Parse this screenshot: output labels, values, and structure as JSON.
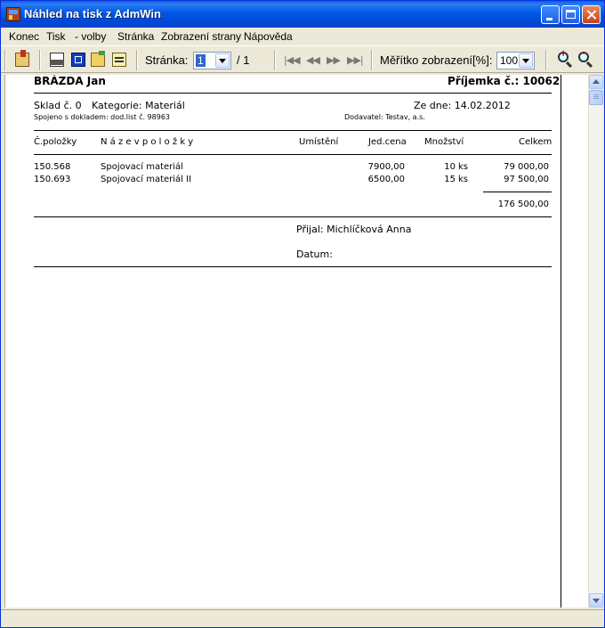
{
  "window": {
    "title": "Náhled na tisk z AdmWin"
  },
  "menu": {
    "konec": "Konec",
    "tisk": "Tisk",
    "volby": " - volby",
    "stranka": "Stránka",
    "zobrazeni": "Zobrazení strany",
    "napoveda": "Nápověda"
  },
  "toolbar": {
    "page_label": "Stránka:",
    "page_value": "1",
    "page_total": "/ 1",
    "zoom_label": "Měřítko zobrazení[%]:",
    "zoom_value": "100"
  },
  "document": {
    "name": "BRÁZDA Jan",
    "doc_title": "Příjemka č.: 10062",
    "sklad": "Sklad č. 0",
    "kategorie": "Kategorie: Materiál",
    "ze_dne": "Ze dne: 14.02.2012",
    "spojeno": "Spojeno s dokladem: dod.list č. 98963",
    "dodavatel": "Dodavatel: Testav, a.s.",
    "columns": {
      "cislo": "Č.položky",
      "nazev": "N á z e v   p o l o ž k y",
      "umisteni": "Umístění",
      "jedcena": "Jed.cena",
      "mnozstvi": "Množství",
      "celkem": "Celkem"
    },
    "rows": [
      {
        "cislo": "150.568",
        "nazev": "Spojovací materiál",
        "jedcena": "7900,00",
        "mnozstvi": "10",
        "jednotka": "ks",
        "celkem": "79 000,00"
      },
      {
        "cislo": "150.693",
        "nazev": "Spojovací materiál II",
        "jedcena": "6500,00",
        "mnozstvi": "15",
        "jednotka": "ks",
        "celkem": "97 500,00"
      }
    ],
    "total": "176 500,00",
    "prijal": "Přijal: Michlíčková Anna",
    "datum": "Datum:"
  }
}
